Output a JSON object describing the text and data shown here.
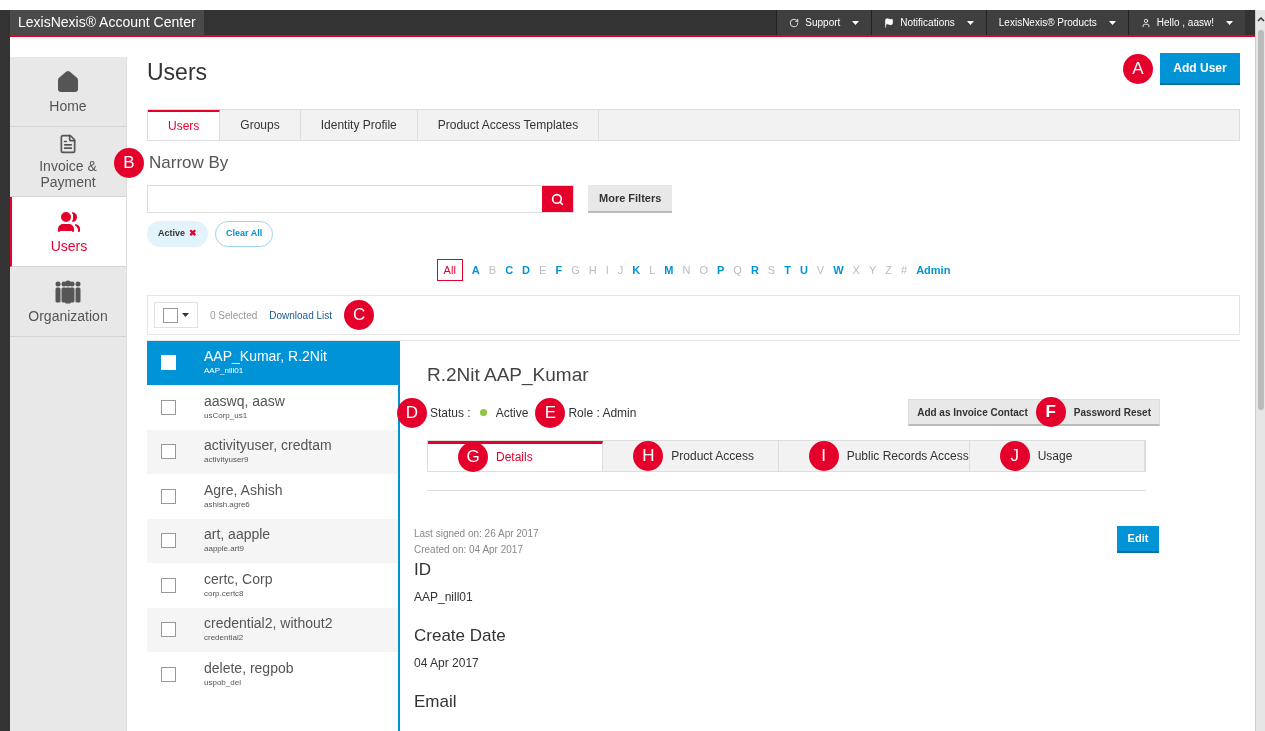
{
  "topbar": {
    "title": "LexisNexis® Account Center",
    "menus": [
      {
        "label": "Support"
      },
      {
        "label": "Notifications"
      },
      {
        "label": "LexisNexis® Products"
      },
      {
        "label": "Hello , aasw!"
      }
    ]
  },
  "sidebar": [
    {
      "label": "Home",
      "selected": false
    },
    {
      "label": "Invoice & Payment",
      "selected": false
    },
    {
      "label": "Users",
      "selected": true
    },
    {
      "label": "Organization",
      "selected": false
    }
  ],
  "page_title": "Users",
  "add_user": {
    "label": "Add User",
    "callout": "A"
  },
  "tabs": [
    {
      "label": "Users",
      "selected": true
    },
    {
      "label": "Groups",
      "selected": false
    },
    {
      "label": "Identity Profile",
      "selected": false
    },
    {
      "label": "Product Access Templates",
      "selected": false
    }
  ],
  "narrow_by": {
    "title": "Narrow By",
    "callout": "B"
  },
  "more_filters": "More Filters",
  "filter_chips": [
    {
      "label": "Active",
      "remove": "✖"
    },
    {
      "label": "Clear All"
    }
  ],
  "alphabet": [
    {
      "label": "All",
      "selected": true,
      "enabled": true
    },
    {
      "label": "A",
      "selected": false,
      "enabled": true
    },
    {
      "label": "B",
      "selected": false,
      "enabled": false
    },
    {
      "label": "C",
      "selected": false,
      "enabled": true
    },
    {
      "label": "D",
      "selected": false,
      "enabled": true
    },
    {
      "label": "E",
      "selected": false,
      "enabled": false
    },
    {
      "label": "F",
      "selected": false,
      "enabled": true
    },
    {
      "label": "G",
      "selected": false,
      "enabled": false
    },
    {
      "label": "H",
      "selected": false,
      "enabled": false
    },
    {
      "label": "I",
      "selected": false,
      "enabled": false
    },
    {
      "label": "J",
      "selected": false,
      "enabled": false
    },
    {
      "label": "K",
      "selected": false,
      "enabled": true
    },
    {
      "label": "L",
      "selected": false,
      "enabled": false
    },
    {
      "label": "M",
      "selected": false,
      "enabled": true
    },
    {
      "label": "N",
      "selected": false,
      "enabled": false
    },
    {
      "label": "O",
      "selected": false,
      "enabled": false
    },
    {
      "label": "P",
      "selected": false,
      "enabled": true
    },
    {
      "label": "Q",
      "selected": false,
      "enabled": false
    },
    {
      "label": "R",
      "selected": false,
      "enabled": true
    },
    {
      "label": "S",
      "selected": false,
      "enabled": false
    },
    {
      "label": "T",
      "selected": false,
      "enabled": true
    },
    {
      "label": "U",
      "selected": false,
      "enabled": true
    },
    {
      "label": "V",
      "selected": false,
      "enabled": false
    },
    {
      "label": "W",
      "selected": false,
      "enabled": true
    },
    {
      "label": "X",
      "selected": false,
      "enabled": false
    },
    {
      "label": "Y",
      "selected": false,
      "enabled": false
    },
    {
      "label": "Z",
      "selected": false,
      "enabled": false
    },
    {
      "label": "#",
      "selected": false,
      "enabled": false
    },
    {
      "label": "Admin",
      "selected": false,
      "enabled": true
    }
  ],
  "selection_bar": {
    "checked": false,
    "count": "0 Selected",
    "download": "Download List",
    "callout": "C"
  },
  "users": [
    {
      "name": "AAP_Kumar, R.2Nit",
      "id": "AAP_nill01",
      "selected": true,
      "checked": false
    },
    {
      "name": "aaswq, aasw",
      "id": "usCorp_us1",
      "selected": false,
      "checked": false
    },
    {
      "name": "activityuser, credtam",
      "id": "activityuser9",
      "selected": false,
      "checked": false
    },
    {
      "name": "Agre, Ashish",
      "id": "ashish.agre6",
      "selected": false,
      "checked": false
    },
    {
      "name": "art, aapple",
      "id": "aapple.art9",
      "selected": false,
      "checked": false
    },
    {
      "name": "certc, Corp",
      "id": "corp.certc8",
      "selected": false,
      "checked": false
    },
    {
      "name": "credential2, without2",
      "id": "credential2",
      "selected": false,
      "checked": false
    },
    {
      "name": "delete, regpob",
      "id": "uspob_del",
      "selected": false,
      "checked": false
    }
  ],
  "detail": {
    "name": "R.2Nit AAP_Kumar",
    "status_label": "Status :",
    "status_callout": "D",
    "status": "Active",
    "role_callout": "E",
    "role": "Role : Admin",
    "actions": [
      {
        "label": "Add as Invoice Contact"
      },
      {
        "label": "Password Reset",
        "callout": "F"
      }
    ],
    "tabs": [
      {
        "label": "Details",
        "selected": true,
        "callout": "G"
      },
      {
        "label": "Product Access",
        "selected": false,
        "callout": "H"
      },
      {
        "label": "Public Records Access",
        "selected": false,
        "callout": "I"
      },
      {
        "label": "Usage",
        "selected": false,
        "callout": "J"
      }
    ],
    "meta": [
      "Last signed on: 26 Apr 2017",
      "Created on: 04 Apr 2017"
    ],
    "edit": "Edit",
    "fields": [
      {
        "label": "ID",
        "value": "AAP_nill01"
      },
      {
        "label": "Create Date",
        "value": "04 Apr 2017"
      },
      {
        "label": "Email"
      }
    ]
  }
}
